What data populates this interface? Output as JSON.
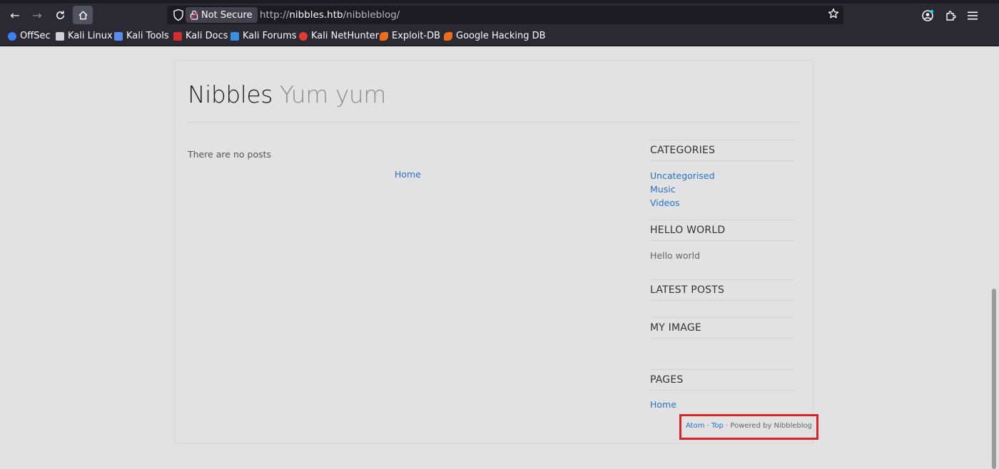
{
  "browser": {
    "url_security_label": "Not Secure",
    "url_scheme": "http://",
    "url_host": "nibbles.htb",
    "url_path": "/nibbleblog/",
    "bookmarks": [
      {
        "label": "OffSec",
        "icon": "offsec-icon",
        "color": "#3b82f6"
      },
      {
        "label": "Kali Linux",
        "icon": "kali-dragon-icon",
        "color": "#cfcfd8"
      },
      {
        "label": "Kali Tools",
        "icon": "kali-tools-icon",
        "color": "#5b8dee"
      },
      {
        "label": "Kali Docs",
        "icon": "kali-docs-icon",
        "color": "#d32f2f"
      },
      {
        "label": "Kali Forums",
        "icon": "kali-forums-icon",
        "color": "#3a8fe0"
      },
      {
        "label": "Kali NetHunter",
        "icon": "kali-nethunter-icon",
        "color": "#e53935"
      },
      {
        "label": "Exploit-DB",
        "icon": "exploit-db-icon",
        "color": "#f26b1d"
      },
      {
        "label": "Google Hacking DB",
        "icon": "google-hacking-db-icon",
        "color": "#f26b1d"
      }
    ]
  },
  "site": {
    "title": "Nibbles",
    "subtitle": "Yum yum",
    "no_posts": "There are no posts",
    "home_link": "Home"
  },
  "sidebar": {
    "categories": {
      "heading": "CATEGORIES",
      "items": [
        "Uncategorised",
        "Music",
        "Videos"
      ]
    },
    "hello_world": {
      "heading": "HELLO WORLD",
      "text": "Hello world"
    },
    "latest_posts": {
      "heading": "LATEST POSTS"
    },
    "my_image": {
      "heading": "MY IMAGE"
    },
    "pages": {
      "heading": "PAGES",
      "items": [
        "Home"
      ]
    }
  },
  "footer": {
    "atom": "Atom",
    "sep1": " · ",
    "top": "Top",
    "powered": " · Powered by Nibbleblog"
  },
  "colors": {
    "link": "#2673c5",
    "highlight_box": "#d8232a",
    "page_bg": "#e2e2e2",
    "chrome_bg": "#2b2a33"
  }
}
